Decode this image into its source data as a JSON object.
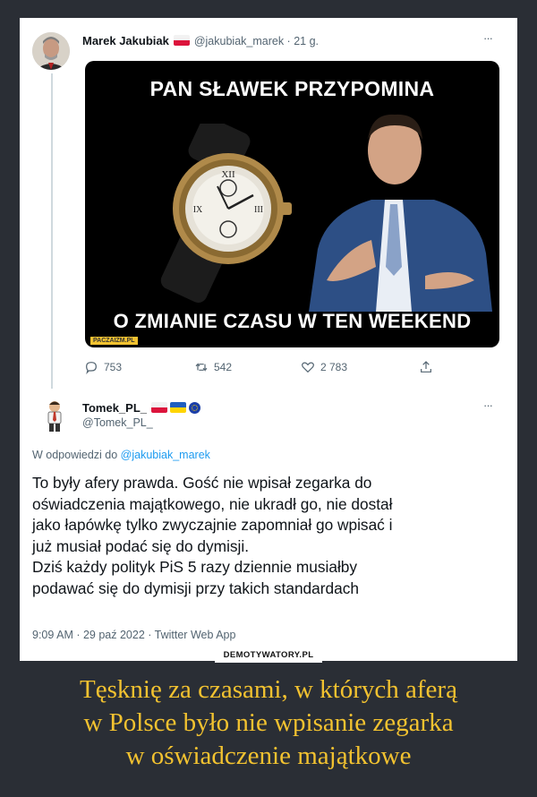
{
  "tweet": {
    "author_name": "Marek Jakubiak",
    "author_handle": "@jakubiak_marek",
    "time_sep": " · ",
    "time": "21 g.",
    "more": "···",
    "image": {
      "top_text": "PAN SŁAWEK PRZYPOMINA",
      "bottom_text": "O ZMIANIE CZASU W TEN WEEKEND",
      "watermark": "PACZAIZM.PL"
    },
    "stats": {
      "replies": "753",
      "retweets": "542",
      "likes": "2 783"
    }
  },
  "reply": {
    "author_name": "Tomek_PL_",
    "author_handle": "@Tomek_PL_",
    "more": "···",
    "replying_prefix": "W odpowiedzi do ",
    "replying_to": "@jakubiak_marek",
    "lines": [
      "To były afery prawda. Gość nie wpisał zegarka do",
      "oświadczenia majątkowego, nie ukradł go, nie dostał",
      "jako łapówkę tylko zwyczajnie zapomniał go wpisać i",
      "już musiał podać się do dymisji.",
      "Dziś każdy polityk PiS 5 razy dziennie musiałby",
      "podawać się do dymisji przy takich standardach"
    ],
    "timestamp": "9:09 AM · 29 paź 2022 · Twitter Web App"
  },
  "site_watermark": "DEMOTYWATORY.PL",
  "caption": [
    "Tęsknię za czasami, w których aferą",
    "w Polsce było nie wpisanie zegarka",
    "w oświadczenie majątkowe"
  ],
  "colors": {
    "background": "#2a2e35",
    "caption": "#f2c230",
    "link": "#1d9bf0",
    "muted": "#536471"
  },
  "icons": [
    "reply-icon",
    "retweet-icon",
    "like-icon",
    "share-icon",
    "more-icon"
  ]
}
